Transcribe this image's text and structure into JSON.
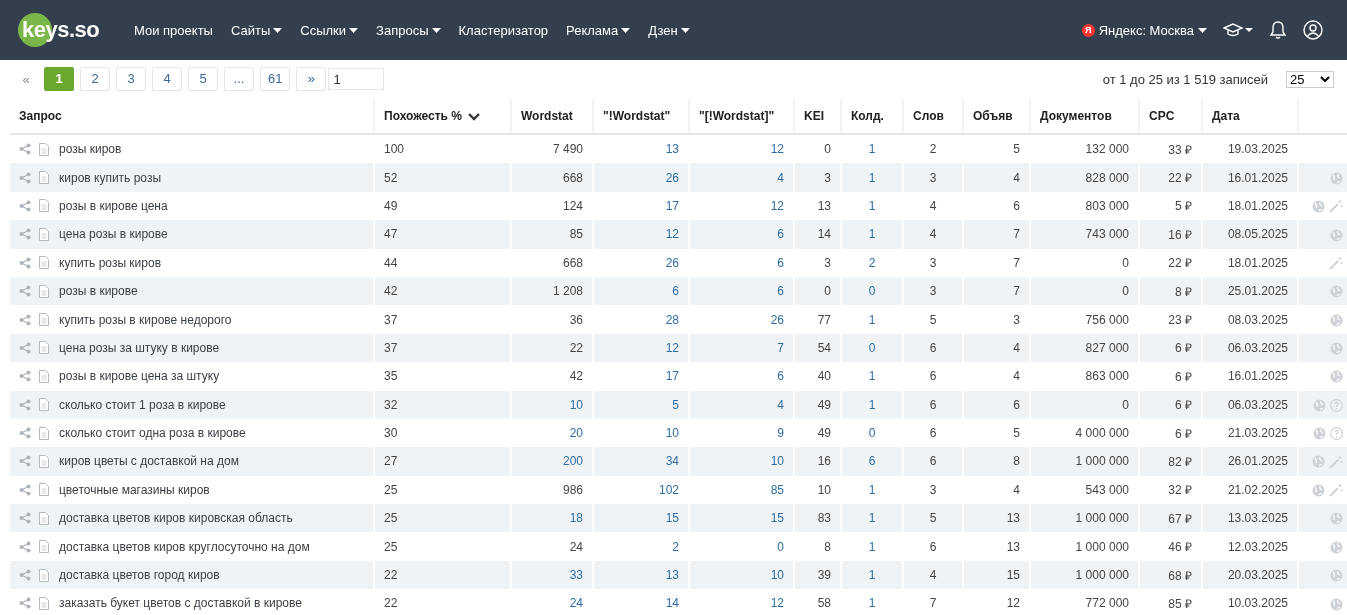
{
  "header": {
    "logo": "keys.so",
    "nav": [
      {
        "label": "Мои проекты",
        "dropdown": false
      },
      {
        "label": "Сайты",
        "dropdown": true
      },
      {
        "label": "Ссылки",
        "dropdown": true
      },
      {
        "label": "Запросы",
        "dropdown": true
      },
      {
        "label": "Кластеризатор",
        "dropdown": false
      },
      {
        "label": "Реклама",
        "dropdown": true
      },
      {
        "label": "Дзен",
        "dropdown": true
      }
    ],
    "region": {
      "badge": "Я",
      "label": "Яндекс: Москва"
    }
  },
  "pagination": {
    "prev": "«",
    "pages": [
      {
        "label": "1",
        "selected": true
      },
      {
        "label": "2",
        "selected": false
      },
      {
        "label": "3",
        "selected": false
      },
      {
        "label": "4",
        "selected": false
      },
      {
        "label": "5",
        "selected": false
      },
      {
        "label": "...",
        "selected": false
      },
      {
        "label": "61",
        "selected": false
      }
    ],
    "next": "»",
    "page_input": "1",
    "summary": "от 1 до 25 из 1 519 записей",
    "page_size": "25"
  },
  "table": {
    "columns": [
      {
        "label": "Запрос",
        "kind": "query",
        "sorted": false
      },
      {
        "label": "Похожесть %",
        "kind": "text",
        "sorted": true
      },
      {
        "label": "Wordstat",
        "kind": "number",
        "sorted": false
      },
      {
        "label": "\"!Wordstat\"",
        "kind": "link",
        "sorted": false
      },
      {
        "label": "\"[!Wordstat]\"",
        "kind": "link",
        "sorted": false
      },
      {
        "label": "KEI",
        "kind": "number",
        "sorted": false
      },
      {
        "label": "Колд.",
        "kind": "center-link",
        "sorted": false
      },
      {
        "label": "Слов",
        "kind": "center",
        "sorted": false
      },
      {
        "label": "Объяв",
        "kind": "number",
        "sorted": false
      },
      {
        "label": "Документов",
        "kind": "number",
        "sorted": false
      },
      {
        "label": "CPC",
        "kind": "number",
        "sorted": false
      },
      {
        "label": "Дата",
        "kind": "number",
        "sorted": false
      }
    ],
    "rows": [
      {
        "cells": [
          "розы киров",
          "100",
          "7 490",
          "13",
          "12",
          "0",
          "1",
          "2",
          "5",
          "132 000",
          "33 ₽",
          "19.03.2025"
        ],
        "wordstat_link": false,
        "actions": []
      },
      {
        "cells": [
          "киров купить розы",
          "52",
          "668",
          "26",
          "4",
          "3",
          "1",
          "3",
          "4",
          "828 000",
          "22 ₽",
          "16.01.2025"
        ],
        "wordstat_link": false,
        "actions": [
          {
            "kind": "globe"
          }
        ]
      },
      {
        "cells": [
          "розы в кирове цена",
          "49",
          "124",
          "17",
          "12",
          "13",
          "1",
          "4",
          "6",
          "803 000",
          "5 ₽",
          "18.01.2025"
        ],
        "wordstat_link": false,
        "actions": [
          {
            "kind": "globe"
          },
          {
            "kind": "wand"
          }
        ]
      },
      {
        "cells": [
          "цена розы в кирове",
          "47",
          "85",
          "12",
          "6",
          "14",
          "1",
          "4",
          "7",
          "743 000",
          "16 ₽",
          "08.05.2025"
        ],
        "wordstat_link": false,
        "actions": [
          {
            "kind": "globe"
          }
        ]
      },
      {
        "cells": [
          "купить розы киров",
          "44",
          "668",
          "26",
          "6",
          "3",
          "2",
          "3",
          "7",
          "0",
          "22 ₽",
          "18.01.2025"
        ],
        "wordstat_link": false,
        "actions": [
          {
            "kind": "wand"
          }
        ]
      },
      {
        "cells": [
          "розы в кирове",
          "42",
          "1 208",
          "6",
          "6",
          "0",
          "0",
          "3",
          "7",
          "0",
          "8 ₽",
          "25.01.2025"
        ],
        "wordstat_link": false,
        "actions": [
          {
            "kind": "globe"
          }
        ]
      },
      {
        "cells": [
          "купить розы в кирове недорого",
          "37",
          "36",
          "28",
          "26",
          "77",
          "1",
          "5",
          "3",
          "756 000",
          "23 ₽",
          "08.03.2025"
        ],
        "wordstat_link": false,
        "actions": [
          {
            "kind": "globe"
          }
        ]
      },
      {
        "cells": [
          "цена розы за штуку в кирове",
          "37",
          "22",
          "12",
          "7",
          "54",
          "0",
          "6",
          "4",
          "827 000",
          "6 ₽",
          "06.03.2025"
        ],
        "wordstat_link": false,
        "actions": [
          {
            "kind": "globe"
          }
        ]
      },
      {
        "cells": [
          "розы в кирове цена за штуку",
          "35",
          "42",
          "17",
          "6",
          "40",
          "1",
          "6",
          "4",
          "863 000",
          "6 ₽",
          "16.01.2025"
        ],
        "wordstat_link": false,
        "actions": [
          {
            "kind": "globe"
          }
        ]
      },
      {
        "cells": [
          "сколько стоит 1 роза в кирове",
          "32",
          "10",
          "5",
          "4",
          "49",
          "1",
          "6",
          "6",
          "0",
          "6 ₽",
          "06.03.2025"
        ],
        "wordstat_link": true,
        "actions": [
          {
            "kind": "globe"
          },
          {
            "kind": "question"
          }
        ]
      },
      {
        "cells": [
          "сколько стоит одна роза в кирове",
          "30",
          "20",
          "10",
          "9",
          "49",
          "0",
          "6",
          "5",
          "4 000 000",
          "6 ₽",
          "21.03.2025"
        ],
        "wordstat_link": true,
        "actions": [
          {
            "kind": "globe"
          },
          {
            "kind": "question"
          }
        ]
      },
      {
        "cells": [
          "киров цветы с доставкой на дом",
          "27",
          "200",
          "34",
          "10",
          "16",
          "6",
          "6",
          "8",
          "1 000 000",
          "82 ₽",
          "26.01.2025"
        ],
        "wordstat_link": true,
        "actions": [
          {
            "kind": "globe"
          },
          {
            "kind": "wand"
          }
        ]
      },
      {
        "cells": [
          "цветочные магазины киров",
          "25",
          "986",
          "102",
          "85",
          "10",
          "1",
          "3",
          "4",
          "543 000",
          "32 ₽",
          "21.02.2025"
        ],
        "wordstat_link": false,
        "actions": [
          {
            "kind": "globe"
          },
          {
            "kind": "wand"
          }
        ]
      },
      {
        "cells": [
          "доставка цветов киров кировская область",
          "25",
          "18",
          "15",
          "15",
          "83",
          "1",
          "5",
          "13",
          "1 000 000",
          "67 ₽",
          "13.03.2025"
        ],
        "wordstat_link": true,
        "actions": [
          {
            "kind": "globe"
          }
        ]
      },
      {
        "cells": [
          "доставка цветов киров круглосуточно на дом",
          "25",
          "24",
          "2",
          "0",
          "8",
          "1",
          "6",
          "13",
          "1 000 000",
          "46 ₽",
          "12.03.2025"
        ],
        "wordstat_link": false,
        "actions": [
          {
            "kind": "globe"
          }
        ]
      },
      {
        "cells": [
          "доставка цветов город киров",
          "22",
          "33",
          "13",
          "10",
          "39",
          "1",
          "4",
          "15",
          "1 000 000",
          "68 ₽",
          "20.03.2025"
        ],
        "wordstat_link": true,
        "actions": [
          {
            "kind": "globe"
          }
        ]
      },
      {
        "cells": [
          "заказать букет цветов с доставкой в кирове",
          "22",
          "24",
          "14",
          "12",
          "58",
          "1",
          "7",
          "12",
          "772 000",
          "85 ₽",
          "10.03.2025"
        ],
        "wordstat_link": true,
        "actions": [
          {
            "kind": "globe"
          }
        ]
      }
    ]
  }
}
